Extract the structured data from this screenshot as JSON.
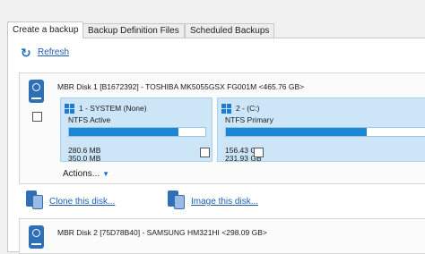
{
  "tabs": [
    {
      "label": "Create a backup",
      "active": true
    },
    {
      "label": "Backup Definition Files",
      "active": false
    },
    {
      "label": "Scheduled Backups",
      "active": false
    }
  ],
  "toolbar": {
    "refresh_label": "Refresh",
    "refresh_icon": "refresh-icon"
  },
  "disks": [
    {
      "title": "MBR Disk 1 [B1672392] - TOSHIBA MK5055GSX FG001M  <465.76 GB>",
      "icon": "hard-disk-icon",
      "checked": false,
      "partitions": [
        {
          "name": "1 - SYSTEM (None)",
          "fs": "NTFS Active",
          "used": "280.6 MB",
          "total": "350.0 MB",
          "fill": 0.8,
          "checked": false
        },
        {
          "name": "2 - (C:)",
          "fs": "NTFS Primary",
          "used": "156.43 GB",
          "total": "231.93 GB",
          "fill": 0.67,
          "checked": false
        }
      ],
      "actions_label": "Actions..."
    },
    {
      "title": "MBR Disk 2 [75D78B40] - SAMSUNG  HM321HI  <298.09 GB>",
      "icon": "hard-disk-icon"
    }
  ],
  "operations": {
    "clone_label": "Clone this disk...",
    "image_label": "Image this disk..."
  },
  "colors": {
    "accent": "#1b86d6",
    "link": "#1f5fb0",
    "partition_bg": "#cde6f7"
  }
}
